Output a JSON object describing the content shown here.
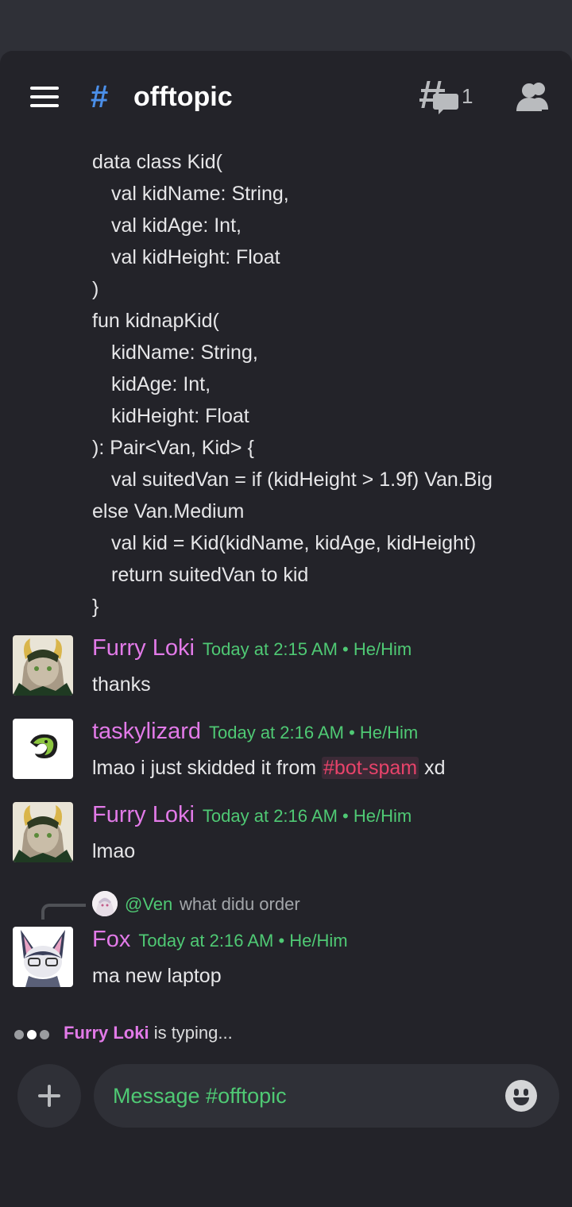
{
  "header": {
    "hash": "#",
    "channel": "offtopic",
    "threads_count": "1"
  },
  "code_message": {
    "lines": [
      {
        "text": "data class Kid(",
        "indent": false
      },
      {
        "text": "val kidName: String,",
        "indent": true
      },
      {
        "text": "val kidAge: Int,",
        "indent": true
      },
      {
        "text": "val kidHeight: Float",
        "indent": true
      },
      {
        "text": ")",
        "indent": false
      },
      {
        "text": "fun kidnapKid(",
        "indent": false
      },
      {
        "text": "kidName: String,",
        "indent": true
      },
      {
        "text": "kidAge: Int,",
        "indent": true
      },
      {
        "text": "kidHeight: Float",
        "indent": true
      },
      {
        "text": "): Pair<Van, Kid> {",
        "indent": false
      },
      {
        "text": "val suitedVan = if (kidHeight > 1.9f) Van.Big",
        "indent": true
      },
      {
        "text": "else Van.Medium",
        "indent": false
      },
      {
        "text": "val kid = Kid(kidName, kidAge, kidHeight)",
        "indent": true
      },
      {
        "text": "return suitedVan to kid",
        "indent": true
      },
      {
        "text": "}",
        "indent": false
      }
    ]
  },
  "messages": [
    {
      "author": "Furry Loki",
      "meta": "Today at 2:15 AM • He/Him",
      "text": "thanks",
      "author_color": "#e27ae8"
    },
    {
      "author": "taskylizard",
      "meta": "Today at 2:16 AM • He/Him",
      "text_before": "lmao i just skidded it from ",
      "mention": "#bot-spam",
      "text_after": " xd",
      "author_color": "#e27ae8"
    },
    {
      "author": "Furry Loki",
      "meta": "Today at 2:16 AM • He/Him",
      "text": "lmao",
      "author_color": "#e27ae8"
    },
    {
      "author": "Fox",
      "meta": "Today at 2:16 AM • He/Him",
      "text": "ma new laptop",
      "author_color": "#e27ae8"
    }
  ],
  "reply": {
    "user": "@Ven",
    "text": "what didu order"
  },
  "typing": {
    "user": "Furry Loki",
    "text": " is typing..."
  },
  "composer": {
    "placeholder": "Message #offtopic"
  },
  "colors": {
    "accent_blue": "#4b8fe8",
    "name_pink": "#e27ae8",
    "meta_green": "#4fc974",
    "mention_red": "#e8436a"
  },
  "icons": [
    "hamburger-icon",
    "threads-icon",
    "members-icon",
    "plus-icon",
    "emoji-icon"
  ]
}
